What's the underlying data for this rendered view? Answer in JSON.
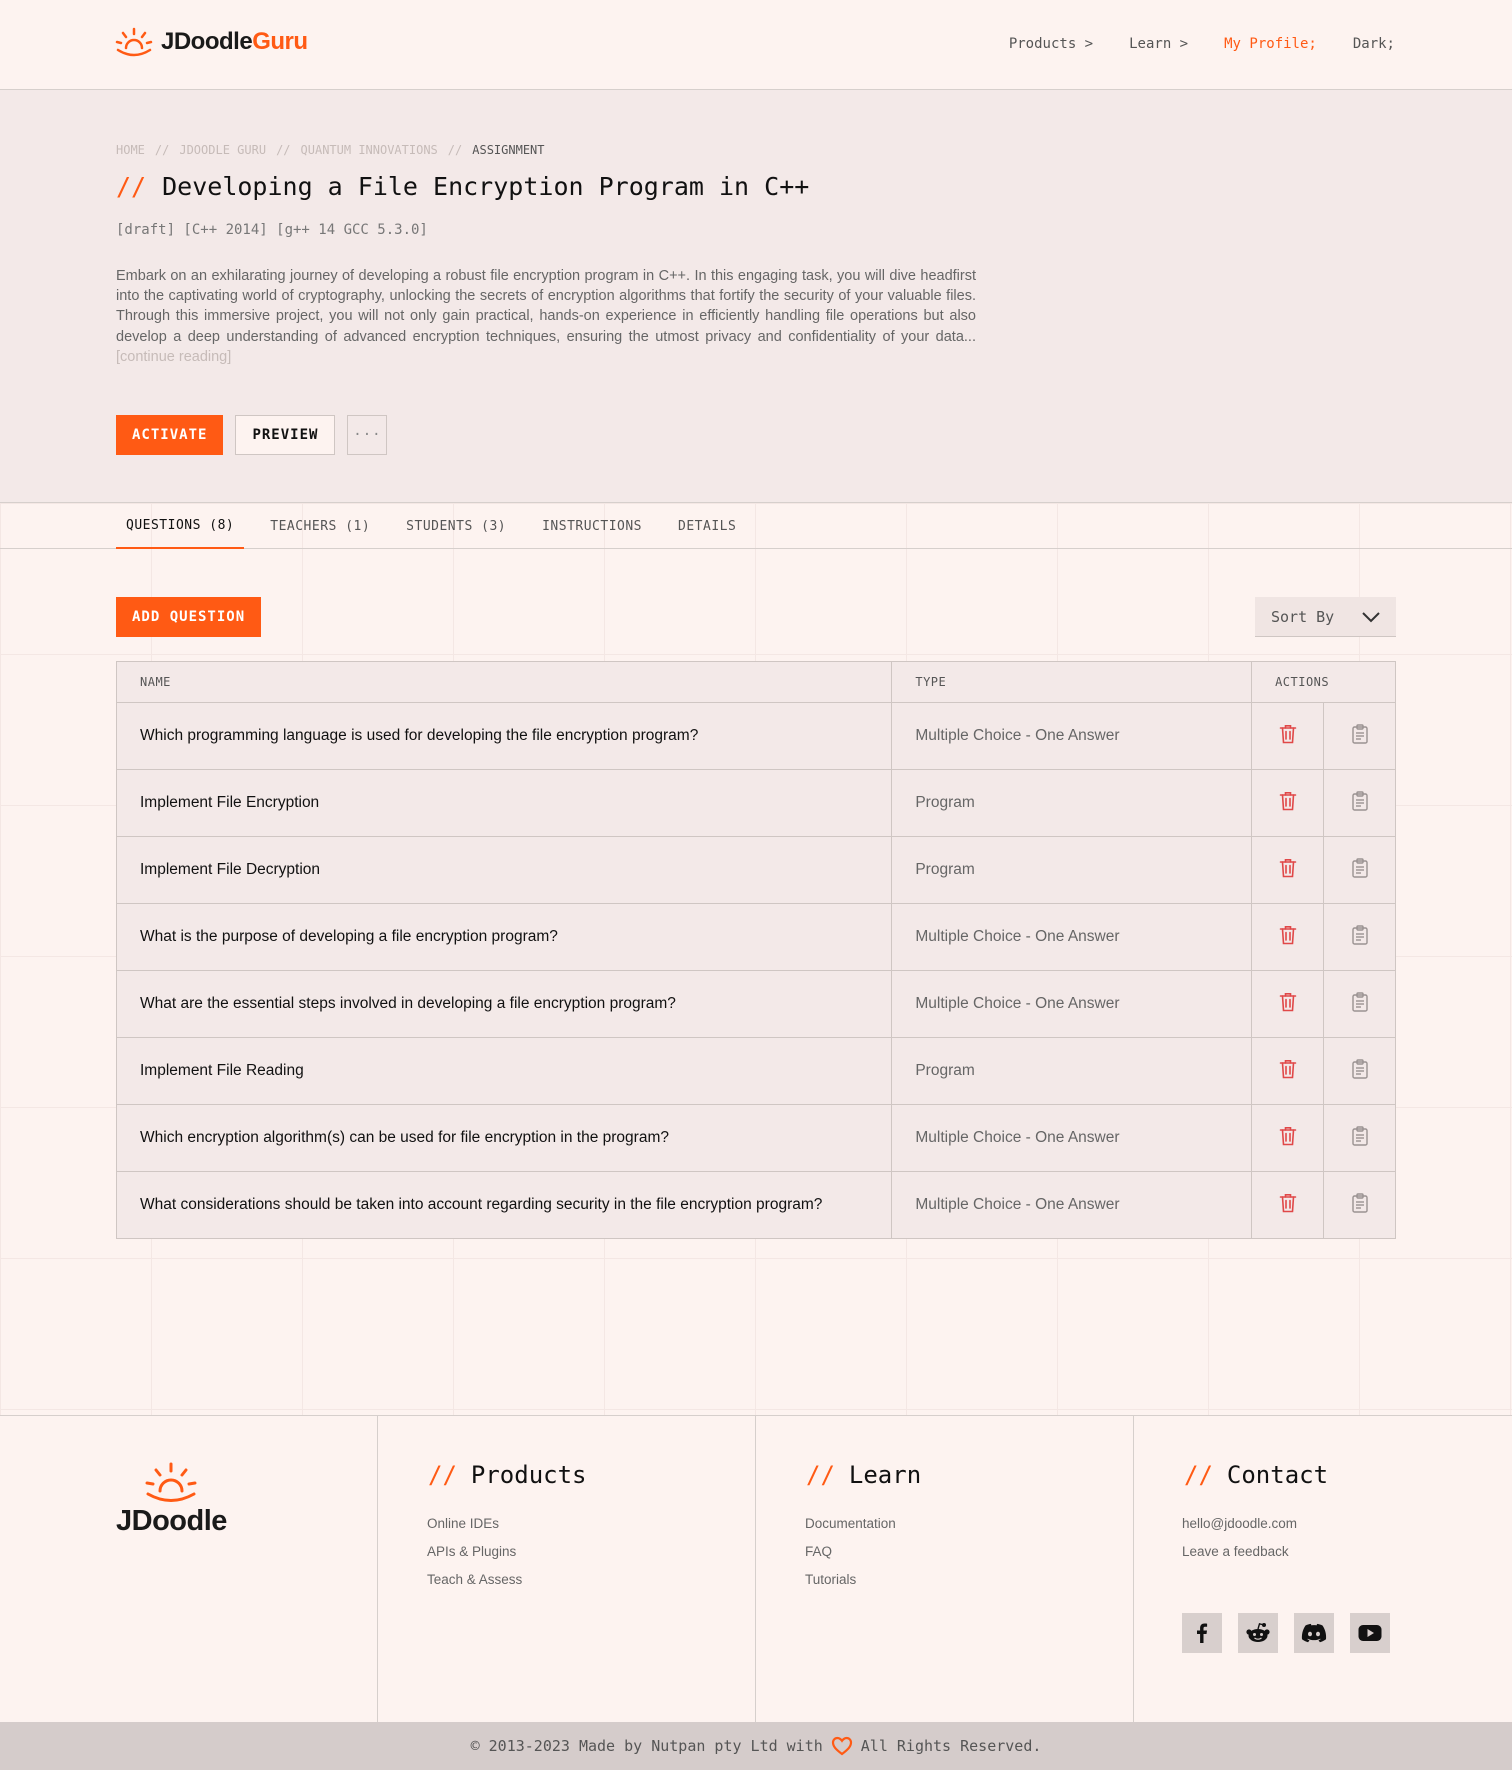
{
  "header": {
    "logo_main": "JDoodle",
    "logo_accent": "Guru",
    "nav": [
      "Products >",
      "Learn >",
      "My Profile;",
      "Dark;"
    ]
  },
  "hero": {
    "breadcrumb": [
      "HOME",
      "//",
      "JDOODLE GURU",
      "//",
      "QUANTUM INNOVATIONS",
      "//",
      "ASSIGNMENT"
    ],
    "title_prefix": "//",
    "title": "Developing a File Encryption Program in C++",
    "tags": "[draft] [C++ 2014] [g++ 14 GCC 5.3.0]",
    "description": "Embark on an exhilarating journey of developing a robust file encryption program in C++. In this engaging task, you will dive headfirst into the captivating world of cryptography, unlocking the secrets of encryption algorithms that fortify the security of your valuable files. Through this immersive project, you will not only gain practical, hands-on experience in efficiently handling file operations but also develop a deep understanding of advanced encryption techniques, ensuring the utmost privacy and confidentiality of your data...",
    "continue": "[continue reading]",
    "activate": "ACTIVATE",
    "preview": "PREVIEW",
    "more": "···"
  },
  "tabs": [
    "QUESTIONS (8)",
    "TEACHERS (1)",
    "STUDENTS (3)",
    "INSTRUCTIONS",
    "DETAILS"
  ],
  "toolbar": {
    "add_question": "ADD QUESTION",
    "sort_by": "Sort By"
  },
  "table": {
    "columns": [
      "NAME",
      "TYPE",
      "ACTIONS"
    ],
    "rows": [
      {
        "name": "Which programming language is used for developing the file encryption program?",
        "type": "Multiple Choice - One Answer"
      },
      {
        "name": "Implement File Encryption",
        "type": "Program"
      },
      {
        "name": "Implement File Decryption",
        "type": "Program"
      },
      {
        "name": "What is the purpose of developing a file encryption program?",
        "type": "Multiple Choice - One Answer"
      },
      {
        "name": "What are the essential steps involved in developing a file encryption program?",
        "type": "Multiple Choice - One Answer"
      },
      {
        "name": "Implement File Reading",
        "type": "Program"
      },
      {
        "name": "Which encryption algorithm(s) can be used for file encryption in the program?",
        "type": "Multiple Choice - One Answer"
      },
      {
        "name": "What considerations should be taken into account regarding security in the file encryption program?",
        "type": "Multiple Choice - One Answer"
      }
    ]
  },
  "footer": {
    "logo": "JDoodle",
    "slash": "//",
    "products": {
      "title": "Products",
      "links": [
        "Online IDEs",
        "APIs & Plugins",
        "Teach & Assess"
      ]
    },
    "learn": {
      "title": "Learn",
      "links": [
        "Documentation",
        "FAQ",
        "Tutorials"
      ]
    },
    "contact": {
      "title": "Contact",
      "links": [
        "hello@jdoodle.com",
        "Leave a feedback"
      ]
    },
    "social_icons": [
      "facebook-icon",
      "reddit-icon",
      "discord-icon",
      "youtube-icon"
    ],
    "copyright_left": "© 2013-2023 Made by Nutpan pty Ltd with",
    "copyright_right": "All Rights Reserved."
  },
  "colors": {
    "accent": "#ff5a14",
    "danger": "#e04848"
  }
}
